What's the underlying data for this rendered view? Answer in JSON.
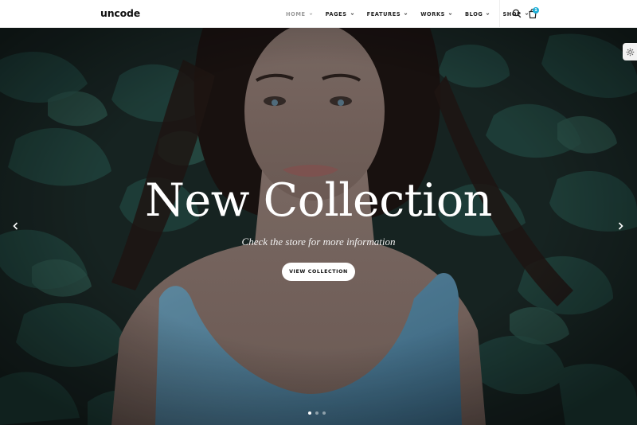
{
  "header": {
    "logo": "uncode",
    "nav": [
      {
        "label": "HOME",
        "active": true
      },
      {
        "label": "PAGES",
        "active": false
      },
      {
        "label": "FEATURES",
        "active": false
      },
      {
        "label": "WORKS",
        "active": false
      },
      {
        "label": "BLOG",
        "active": false
      },
      {
        "label": "SHOP",
        "active": false
      }
    ],
    "cart_count": "1"
  },
  "hero": {
    "title": "New Collection",
    "subtitle": "Check the store for more information",
    "cta_label": "VIEW COLLECTION",
    "slides": 3,
    "active_slide": 1
  },
  "colors": {
    "accent": "#1fb0d8",
    "header_bg": "#ffffff",
    "foliage": "#1f3b36",
    "dress": "#5f8fa8"
  },
  "icons": [
    "search-icon",
    "cart-icon",
    "chevron-down-icon",
    "arrow-left-icon",
    "arrow-right-icon",
    "gear-icon"
  ]
}
